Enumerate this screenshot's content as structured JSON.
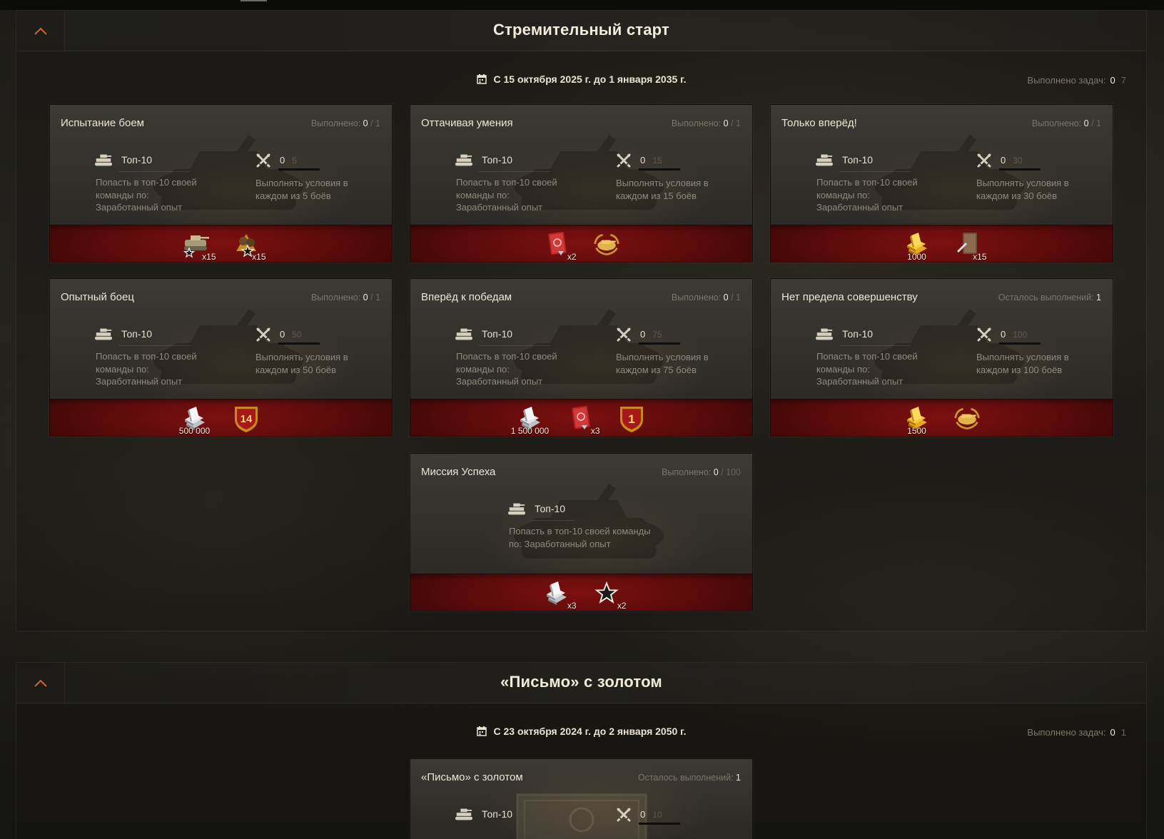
{
  "sections": [
    {
      "title": "Стремительный старт",
      "date_range": "С 15 октября 2025 г. до 1 января 2035 г.",
      "tasks_label": "Выполнено задач:",
      "tasks_done": "0",
      "tasks_total": "7",
      "cards": [
        {
          "title": "Испытание боем",
          "status_label": "Выполнено:",
          "status_value": "0",
          "status_total": "/ 1",
          "condition_label": "Топ-10",
          "condition_desc": "Попасть в топ-10 своей команды по: Заработанный опыт",
          "progress_current": "0",
          "progress_total": "5",
          "progress_desc": "Выполнять условия в каждом из 5 боёв",
          "rewards": [
            {
              "icon": "tank-star-icon",
              "qty": "x15"
            },
            {
              "icon": "crew-star-icon",
              "qty": "x15"
            }
          ]
        },
        {
          "title": "Оттачивая умения",
          "status_label": "Выполнено:",
          "status_value": "0",
          "status_total": "/ 1",
          "condition_label": "Топ-10",
          "condition_desc": "Попасть в топ-10 своей команды по: Заработанный опыт",
          "progress_current": "0",
          "progress_total": "15",
          "progress_desc": "Выполнять условия в каждом из 15 боёв",
          "rewards": [
            {
              "icon": "red-booklet-icon",
              "qty": "x2"
            },
            {
              "icon": "gold-tank-emblem-icon",
              "qty": ""
            }
          ]
        },
        {
          "title": "Только вперёд!",
          "status_label": "Выполнено:",
          "status_value": "0",
          "status_total": "/ 1",
          "condition_label": "Топ-10",
          "condition_desc": "Попасть в топ-10 своей команды по: Заработанный опыт",
          "progress_current": "0",
          "progress_total": "30",
          "progress_desc": "Выполнять условия в каждом из 30 боёв",
          "rewards": [
            {
              "icon": "gold-bars-icon",
              "qty": "1000"
            },
            {
              "icon": "crew-book-icon",
              "qty": "x15"
            }
          ]
        },
        {
          "title": "Опытный боец",
          "status_label": "Выполнено:",
          "status_value": "0",
          "status_total": "/ 1",
          "condition_label": "Топ-10",
          "condition_desc": "Попасть в топ-10 своей команды по: Заработанный опыт",
          "progress_current": "0",
          "progress_total": "50",
          "progress_desc": "Выполнять условия в каждом из 50 боёв",
          "rewards": [
            {
              "icon": "silver-bars-icon",
              "qty": "500 000"
            },
            {
              "icon": "badge-14-icon",
              "qty": "",
              "badge_text": "14"
            }
          ]
        },
        {
          "title": "Вперёд к победам",
          "status_label": "Выполнено:",
          "status_value": "0",
          "status_total": "/ 1",
          "condition_label": "Топ-10",
          "condition_desc": "Попасть в топ-10 своей команды по: Заработанный опыт",
          "progress_current": "0",
          "progress_total": "75",
          "progress_desc": "Выполнять условия в каждом из 75 боёв",
          "rewards": [
            {
              "icon": "silver-bars-icon",
              "qty": "1 500 000"
            },
            {
              "icon": "red-booklet-icon",
              "qty": "x3"
            },
            {
              "icon": "badge-1-icon",
              "qty": "",
              "badge_text": "1"
            }
          ]
        },
        {
          "title": "Нет предела совершенству",
          "status_label": "Осталось выполнений:",
          "status_value": "1",
          "status_total": "",
          "condition_label": "Топ-10",
          "condition_desc": "Попасть в топ-10 своей команды по: Заработанный опыт",
          "progress_current": "0",
          "progress_total": "100",
          "progress_desc": "Выполнять условия в каждом из 100 боёв",
          "rewards": [
            {
              "icon": "gold-bars-icon",
              "qty": "1500"
            },
            {
              "icon": "gold-tank-emblem-icon",
              "qty": ""
            }
          ]
        },
        {
          "title": "Миссия Успеха",
          "status_label": "Выполнено:",
          "status_value": "0",
          "status_total": "/ 100",
          "condition_label": "Топ-10",
          "condition_desc": "Попасть в топ-10 своей команды по: Заработанный опыт",
          "rewards": [
            {
              "icon": "silver-bars-icon",
              "qty": "x3"
            },
            {
              "icon": "star-icon",
              "qty": "x2"
            }
          ]
        }
      ]
    },
    {
      "title": "«Письмо» с золотом",
      "date_range": "С 23 октября 2024 г. до 2 января 2050 г.",
      "tasks_label": "Выполнено задач:",
      "tasks_done": "0",
      "tasks_total": "1",
      "cards": [
        {
          "title": "«Письмо» с золотом",
          "status_label": "Осталось выполнений:",
          "status_value": "1",
          "status_total": "",
          "condition_label": "Топ-10",
          "progress_current": "0",
          "progress_total": "10"
        }
      ]
    }
  ]
}
